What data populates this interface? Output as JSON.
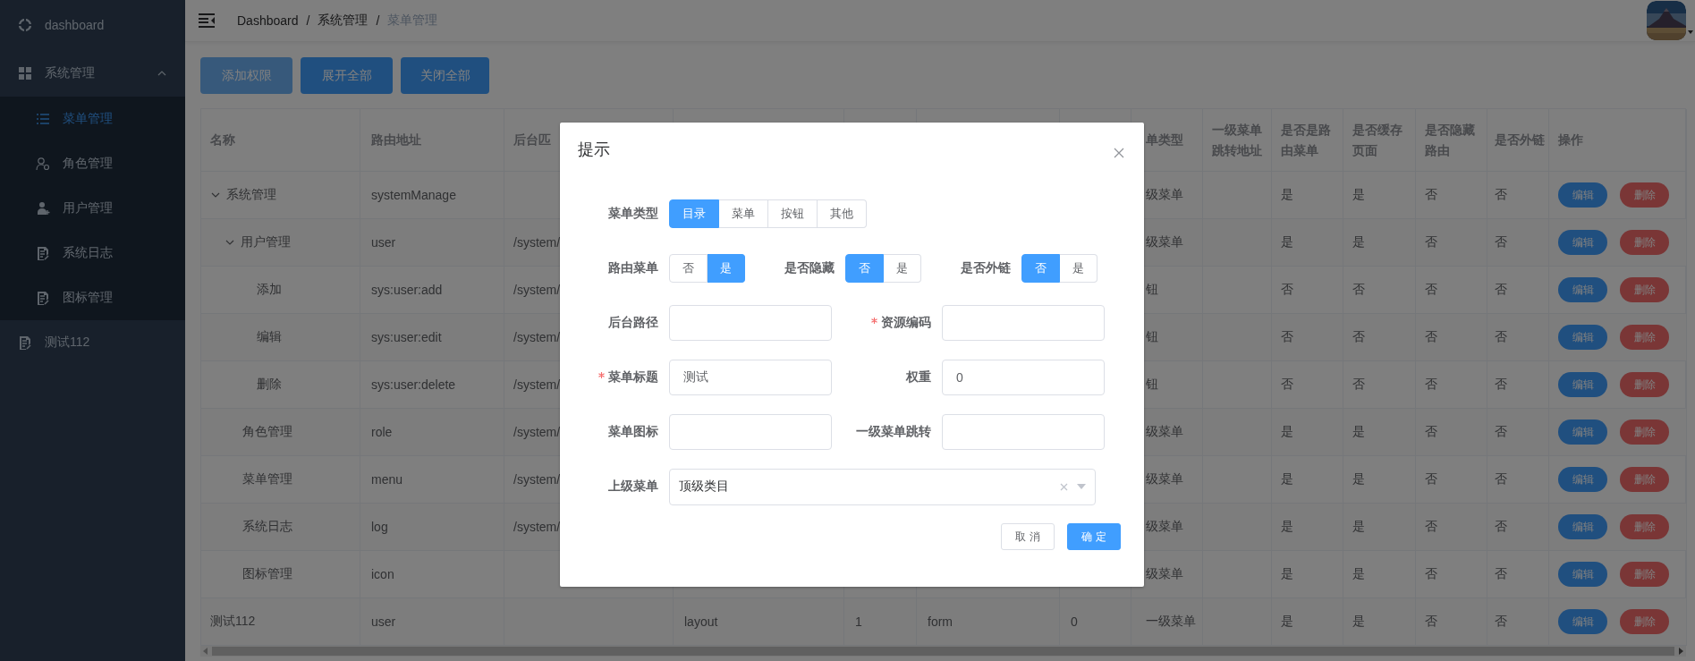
{
  "sidebar": {
    "items": [
      {
        "label": "dashboard",
        "selected": false
      },
      {
        "label": "系统管理",
        "selected": false,
        "expanded": true,
        "children": [
          {
            "label": "菜单管理",
            "selected": true
          },
          {
            "label": "角色管理",
            "selected": false
          },
          {
            "label": "用户管理",
            "selected": false
          },
          {
            "label": "系统日志",
            "selected": false
          },
          {
            "label": "图标管理",
            "selected": false
          }
        ]
      },
      {
        "label": "测试112",
        "selected": false
      }
    ]
  },
  "header": {
    "breadcrumb": {
      "items": [
        "Dashboard",
        "系统管理",
        "菜单管理"
      ],
      "separator": "/"
    }
  },
  "toolbar": {
    "buttons": [
      {
        "label": "添加权限",
        "disabled": true
      },
      {
        "label": "展开全部",
        "disabled": false
      },
      {
        "label": "关闭全部",
        "disabled": false
      }
    ]
  },
  "table": {
    "columns": [
      "名称",
      "路由地址",
      "后台匹",
      null,
      null,
      null,
      null,
      "单类型",
      "一级菜单跳转地址",
      "是否是路由菜单",
      "是否缓存页面",
      "是否隐藏路由",
      "是否外链",
      "操作"
    ],
    "rows": [
      {
        "expanded": true,
        "cells": [
          "系统管理",
          "systemManage",
          "",
          null,
          null,
          null,
          null,
          "级菜单",
          "",
          "是",
          "是",
          "否",
          "否"
        ],
        "actions": [
          {
            "kind": "edit",
            "label": "编辑"
          },
          {
            "kind": "delete",
            "label": "删除"
          }
        ],
        "children": [
          {
            "expanded": true,
            "cells": [
              "用户管理",
              "user",
              "/system/",
              null,
              null,
              null,
              null,
              "级菜单",
              "",
              "是",
              "是",
              "否",
              "否"
            ],
            "actions": [
              {
                "kind": "edit",
                "label": "编辑"
              },
              {
                "kind": "delete",
                "label": "删除"
              }
            ],
            "children": [
              {
                "cells": [
                  "添加",
                  "sys:user:add",
                  "/system/",
                  null,
                  null,
                  null,
                  null,
                  "钮",
                  "",
                  "否",
                  "否",
                  "否",
                  "否"
                ],
                "actions": [
                  {
                    "kind": "edit",
                    "label": "编辑"
                  },
                  {
                    "kind": "delete",
                    "label": "删除"
                  }
                ]
              },
              {
                "cells": [
                  "编辑",
                  "sys:user:edit",
                  "/system/",
                  null,
                  null,
                  null,
                  null,
                  "钮",
                  "",
                  "否",
                  "否",
                  "否",
                  "否"
                ],
                "actions": [
                  {
                    "kind": "edit",
                    "label": "编辑"
                  },
                  {
                    "kind": "delete",
                    "label": "删除"
                  }
                ]
              },
              {
                "cells": [
                  "删除",
                  "sys:user:delete",
                  "/system/",
                  null,
                  null,
                  null,
                  null,
                  "钮",
                  "",
                  "否",
                  "否",
                  "否",
                  "否"
                ],
                "actions": [
                  {
                    "kind": "edit",
                    "label": "编辑"
                  },
                  {
                    "kind": "delete",
                    "label": "删除"
                  }
                ]
              }
            ]
          },
          {
            "cells": [
              "角色管理",
              "role",
              "/system/",
              null,
              null,
              null,
              null,
              "级菜单",
              "",
              "是",
              "是",
              "否",
              "否"
            ],
            "actions": [
              {
                "kind": "edit",
                "label": "编辑"
              },
              {
                "kind": "delete",
                "label": "删除"
              }
            ]
          },
          {
            "cells": [
              "菜单管理",
              "menu",
              "/system/",
              null,
              null,
              null,
              null,
              "级菜单",
              "",
              "是",
              "是",
              "否",
              "否"
            ],
            "actions": [
              {
                "kind": "edit",
                "label": "编辑"
              },
              {
                "kind": "delete",
                "label": "删除"
              }
            ]
          },
          {
            "cells": [
              "系统日志",
              "log",
              "/system/",
              null,
              null,
              null,
              null,
              "级菜单",
              "",
              "是",
              "是",
              "否",
              "否"
            ],
            "actions": [
              {
                "kind": "edit",
                "label": "编辑"
              },
              {
                "kind": "delete",
                "label": "删除"
              }
            ]
          },
          {
            "cells": [
              "图标管理",
              "icon",
              "",
              "",
              "",
              "",
              "",
              "级菜单",
              "",
              "是",
              "是",
              "否",
              "否"
            ],
            "actions": [
              {
                "kind": "edit",
                "label": "编辑"
              },
              {
                "kind": "delete",
                "label": "删除"
              }
            ]
          }
        ]
      },
      {
        "cells": [
          "测试112",
          "user",
          "",
          "layout",
          "1",
          "form",
          "0",
          "一级菜单",
          "",
          "是",
          "是",
          "否",
          "否"
        ],
        "actions": [
          {
            "kind": "edit",
            "label": "编辑"
          },
          {
            "kind": "delete",
            "label": "删除"
          }
        ]
      }
    ]
  },
  "dialog": {
    "title": "提示",
    "rows": [
      [
        {
          "kind": "radio",
          "label": "菜单类型",
          "required": false,
          "options": [
            {
              "label": "目录",
              "selected": true
            },
            {
              "label": "菜单",
              "selected": false
            },
            {
              "label": "按钮",
              "selected": false
            },
            {
              "label": "其他",
              "selected": false
            }
          ]
        }
      ],
      [
        {
          "kind": "radio",
          "label": "路由菜单",
          "required": false,
          "options": [
            {
              "label": "否",
              "selected": false
            },
            {
              "label": "是",
              "selected": true
            }
          ]
        },
        {
          "kind": "radio",
          "label": "是否隐藏",
          "required": false,
          "options": [
            {
              "label": "否",
              "selected": true
            },
            {
              "label": "是",
              "selected": false
            }
          ]
        },
        {
          "kind": "radio",
          "label": "是否外链",
          "required": false,
          "options": [
            {
              "label": "否",
              "selected": true
            },
            {
              "label": "是",
              "selected": false
            }
          ]
        }
      ],
      [
        {
          "kind": "input",
          "label": "后台路径",
          "required": false
        },
        {
          "kind": "input",
          "label": "资源编码",
          "required": true
        }
      ],
      [
        {
          "kind": "input",
          "label": "菜单标题",
          "required": true,
          "value": "测试"
        },
        {
          "kind": "input",
          "label": "权重",
          "required": false,
          "value": "0"
        }
      ],
      [
        {
          "kind": "input",
          "label": "菜单图标",
          "required": false
        },
        {
          "kind": "input",
          "label": "一级菜单跳转",
          "required": false
        }
      ],
      [
        {
          "kind": "select",
          "label": "上级菜单",
          "required": false,
          "value": "顶级类目"
        }
      ]
    ],
    "buttons": [
      {
        "kind": "default",
        "label": "取 消"
      },
      {
        "kind": "primary",
        "label": "确 定"
      }
    ]
  }
}
